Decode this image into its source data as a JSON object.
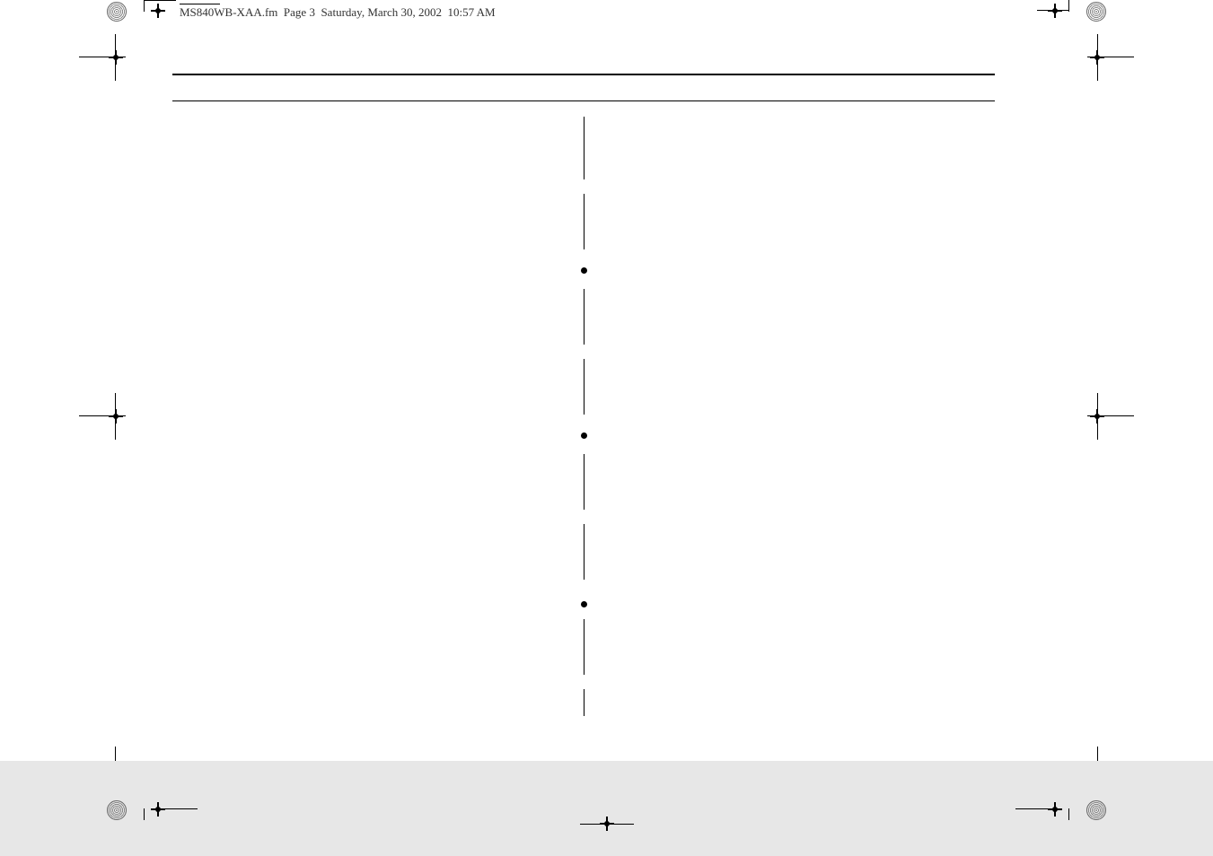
{
  "header": {
    "filename": "MS840WB-XAA.fm",
    "page_label": "Page 3",
    "date": "Saturday, March 30, 2002",
    "time": "10:57 AM"
  }
}
